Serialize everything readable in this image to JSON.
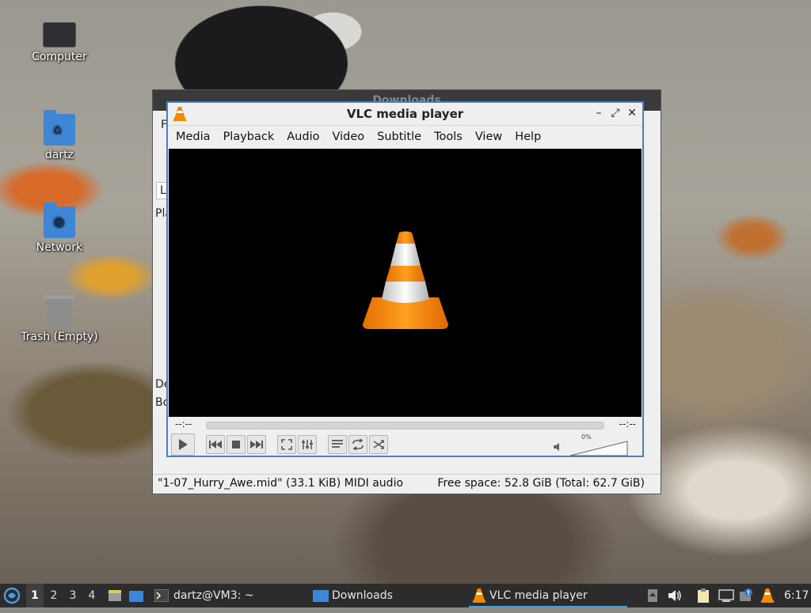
{
  "desktop": {
    "icons": [
      {
        "label": "Computer"
      },
      {
        "label": "dartz"
      },
      {
        "label": "Network"
      },
      {
        "label": "Trash (Empty)"
      }
    ]
  },
  "downloads_window": {
    "title": "Downloads",
    "fragments": [
      "F",
      "Li",
      "Pla",
      "De",
      "Bo"
    ],
    "status_left": "\"1-07_Hurry_Awe.mid\" (33.1 KiB) MIDI audio",
    "status_right": "Free space: 52.8 GiB (Total: 62.7 GiB)"
  },
  "vlc": {
    "title": "VLC media player",
    "window_buttons": {
      "minimize": "–",
      "maximize": "⤢",
      "close": "✕"
    },
    "menu": [
      "Media",
      "Playback",
      "Audio",
      "Video",
      "Subtitle",
      "Tools",
      "View",
      "Help"
    ],
    "elapsed": "--:--",
    "remaining": "--:--",
    "volume_label": "0%",
    "volume_level": 0,
    "progress": 0,
    "accent": "#f28a00"
  },
  "taskbar": {
    "workspaces": [
      "1",
      "2",
      "3",
      "4"
    ],
    "active_workspace": "1",
    "tasks": [
      {
        "label": "dartz@VM3: ~",
        "icon": "terminal-icon"
      },
      {
        "label": "Downloads",
        "icon": "folder-icon"
      },
      {
        "label": "VLC media player",
        "icon": "vlc-cone-icon"
      }
    ],
    "clock": "6:17"
  }
}
